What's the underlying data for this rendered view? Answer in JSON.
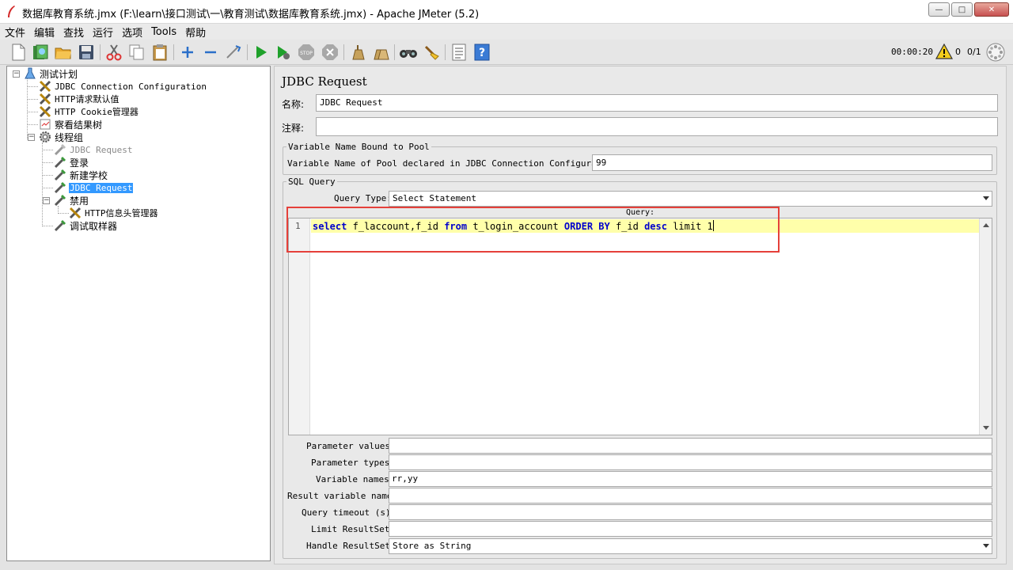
{
  "window": {
    "title": "数据库教育系统.jmx (F:\\learn\\接口测试\\一\\教育测试\\数据库教育系统.jmx) - Apache JMeter (5.2)",
    "minimize": "—",
    "maximize": "□",
    "close": "✕"
  },
  "menu": [
    "文件",
    "编辑",
    "查找",
    "运行",
    "选项",
    "Tools",
    "帮助"
  ],
  "toolbar": {
    "timer": "00:00:20",
    "warning_count": "0",
    "threads": "0/1"
  },
  "tree": {
    "root": "测试计划",
    "children": [
      "JDBC Connection Configuration",
      "HTTP请求默认值",
      "HTTP Cookie管理器",
      "察看结果树",
      "线程组"
    ],
    "thread_group_children": [
      "JDBC Request",
      "登录",
      "新建学校",
      "JDBC Request",
      "禁用",
      "HTTP信息头管理器",
      "调试取样器"
    ]
  },
  "panel": {
    "title": "JDBC Request",
    "name_label": "名称:",
    "name_value": "JDBC Request",
    "comment_label": "注释:",
    "comment_value": "",
    "pool_group_title": "Variable Name Bound to Pool",
    "pool_label": "Variable Name of Pool declared in JDBC Connection Configuration:",
    "pool_value": "99",
    "sql_group_title": "SQL Query",
    "query_type_label": "Query Type:",
    "query_type_value": "Select Statement",
    "query_label": "Query:",
    "line_number": "1",
    "sql": {
      "t1": "select",
      "t2": " f_laccount,f_id ",
      "t3": "from",
      "t4": " t_login_account ",
      "t5": "ORDER BY",
      "t6": " f_id ",
      "t7": "desc",
      "t8": " limit 1"
    },
    "params": [
      {
        "label": "Parameter values:",
        "value": ""
      },
      {
        "label": "Parameter types:",
        "value": ""
      },
      {
        "label": "Variable names:",
        "value": "rr,yy"
      },
      {
        "label": "Result variable name:",
        "value": ""
      },
      {
        "label": "Query timeout (s):",
        "value": ""
      },
      {
        "label": "Limit ResultSet:",
        "value": ""
      }
    ],
    "handle_label": "Handle ResultSet:",
    "handle_value": "Store as String"
  },
  "colors": {
    "highlight_box": "#e5403a",
    "selection": "#3399ff",
    "sql_keyword": "#0000cc",
    "current_line": "#ffffaa"
  }
}
